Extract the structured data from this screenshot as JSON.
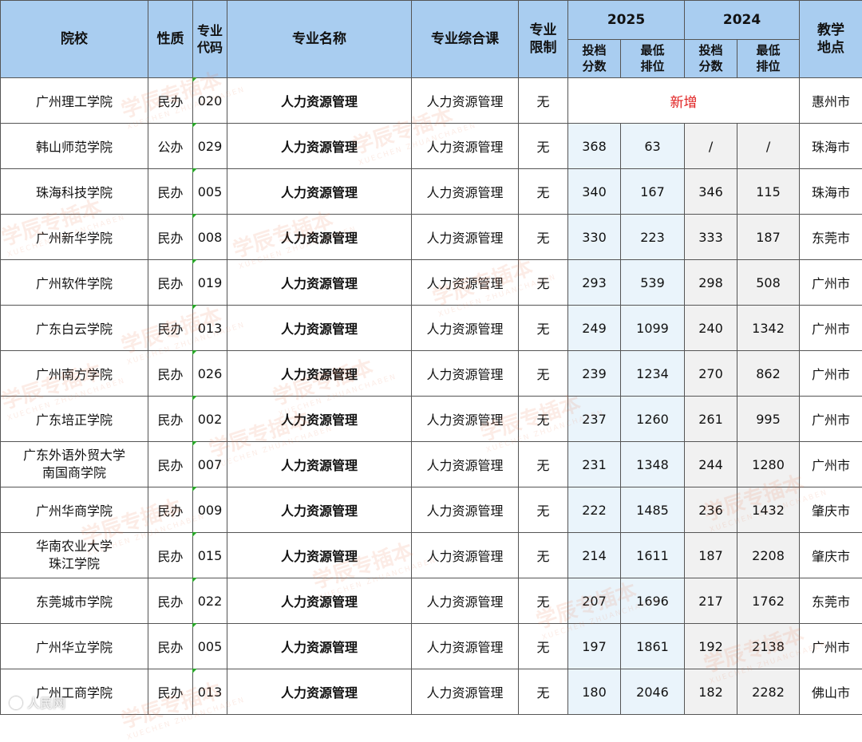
{
  "header": {
    "school": "院校",
    "nature": "性质",
    "code": "专业\n代码",
    "major": "专业名称",
    "course": "专业综合课",
    "limit": "专业\n限制",
    "year_a": "2025",
    "year_b": "2024",
    "score": "投档\n分数",
    "rank": "最低\n排位",
    "location": "教学\n地点"
  },
  "rows": [
    {
      "school": "广州理工学院",
      "nature": "民办",
      "code": "020",
      "major": "人力资源管理",
      "course": "人力资源管理",
      "limit": "无",
      "new_label": "新增",
      "location": "惠州市"
    },
    {
      "school": "韩山师范学院",
      "nature": "公办",
      "code": "029",
      "major": "人力资源管理",
      "course": "人力资源管理",
      "limit": "无",
      "s25": "368",
      "r25": "63",
      "s24": "/",
      "r24": "/",
      "location": "珠海市"
    },
    {
      "school": "珠海科技学院",
      "nature": "民办",
      "code": "005",
      "major": "人力资源管理",
      "course": "人力资源管理",
      "limit": "无",
      "s25": "340",
      "r25": "167",
      "s24": "346",
      "r24": "115",
      "location": "珠海市"
    },
    {
      "school": "广州新华学院",
      "nature": "民办",
      "code": "008",
      "major": "人力资源管理",
      "course": "人力资源管理",
      "limit": "无",
      "s25": "330",
      "r25": "223",
      "s24": "333",
      "r24": "187",
      "location": "东莞市"
    },
    {
      "school": "广州软件学院",
      "nature": "民办",
      "code": "019",
      "major": "人力资源管理",
      "course": "人力资源管理",
      "limit": "无",
      "s25": "293",
      "r25": "539",
      "s24": "298",
      "r24": "508",
      "location": "广州市"
    },
    {
      "school": "广东白云学院",
      "nature": "民办",
      "code": "013",
      "major": "人力资源管理",
      "course": "人力资源管理",
      "limit": "无",
      "s25": "249",
      "r25": "1099",
      "s24": "240",
      "r24": "1342",
      "location": "广州市"
    },
    {
      "school": "广州南方学院",
      "nature": "民办",
      "code": "026",
      "major": "人力资源管理",
      "course": "人力资源管理",
      "limit": "无",
      "s25": "239",
      "r25": "1234",
      "s24": "270",
      "r24": "862",
      "location": "广州市"
    },
    {
      "school": "广东培正学院",
      "nature": "民办",
      "code": "002",
      "major": "人力资源管理",
      "course": "人力资源管理",
      "limit": "无",
      "s25": "237",
      "r25": "1260",
      "s24": "261",
      "r24": "995",
      "location": "广州市"
    },
    {
      "school": "广东外语外贸大学\n南国商学院",
      "nature": "民办",
      "code": "007",
      "major": "人力资源管理",
      "course": "人力资源管理",
      "limit": "无",
      "s25": "231",
      "r25": "1348",
      "s24": "244",
      "r24": "1280",
      "location": "广州市"
    },
    {
      "school": "广州华商学院",
      "nature": "民办",
      "code": "009",
      "major": "人力资源管理",
      "course": "人力资源管理",
      "limit": "无",
      "s25": "222",
      "r25": "1485",
      "s24": "236",
      "r24": "1432",
      "location": "肇庆市"
    },
    {
      "school": "华南农业大学\n珠江学院",
      "nature": "民办",
      "code": "015",
      "major": "人力资源管理",
      "course": "人力资源管理",
      "limit": "无",
      "s25": "214",
      "r25": "1611",
      "s24": "187",
      "r24": "2208",
      "location": "肇庆市"
    },
    {
      "school": "东莞城市学院",
      "nature": "民办",
      "code": "022",
      "major": "人力资源管理",
      "course": "人力资源管理",
      "limit": "无",
      "s25": "207",
      "r25": "1696",
      "s24": "217",
      "r24": "1762",
      "location": "东莞市"
    },
    {
      "school": "广州华立学院",
      "nature": "民办",
      "code": "005",
      "major": "人力资源管理",
      "course": "人力资源管理",
      "limit": "无",
      "s25": "197",
      "r25": "1861",
      "s24": "192",
      "r24": "2138",
      "location": "广州市"
    },
    {
      "school": "广州工商学院",
      "nature": "民办",
      "code": "013",
      "major": "人力资源管理",
      "course": "人力资源管理",
      "limit": "无",
      "s25": "180",
      "r25": "2046",
      "s24": "182",
      "r24": "2282",
      "location": "佛山市"
    }
  ],
  "watermark": {
    "text": "学辰专插本",
    "sub": "XUECHEN ZHUANCHABEN"
  },
  "credit": "人民网"
}
